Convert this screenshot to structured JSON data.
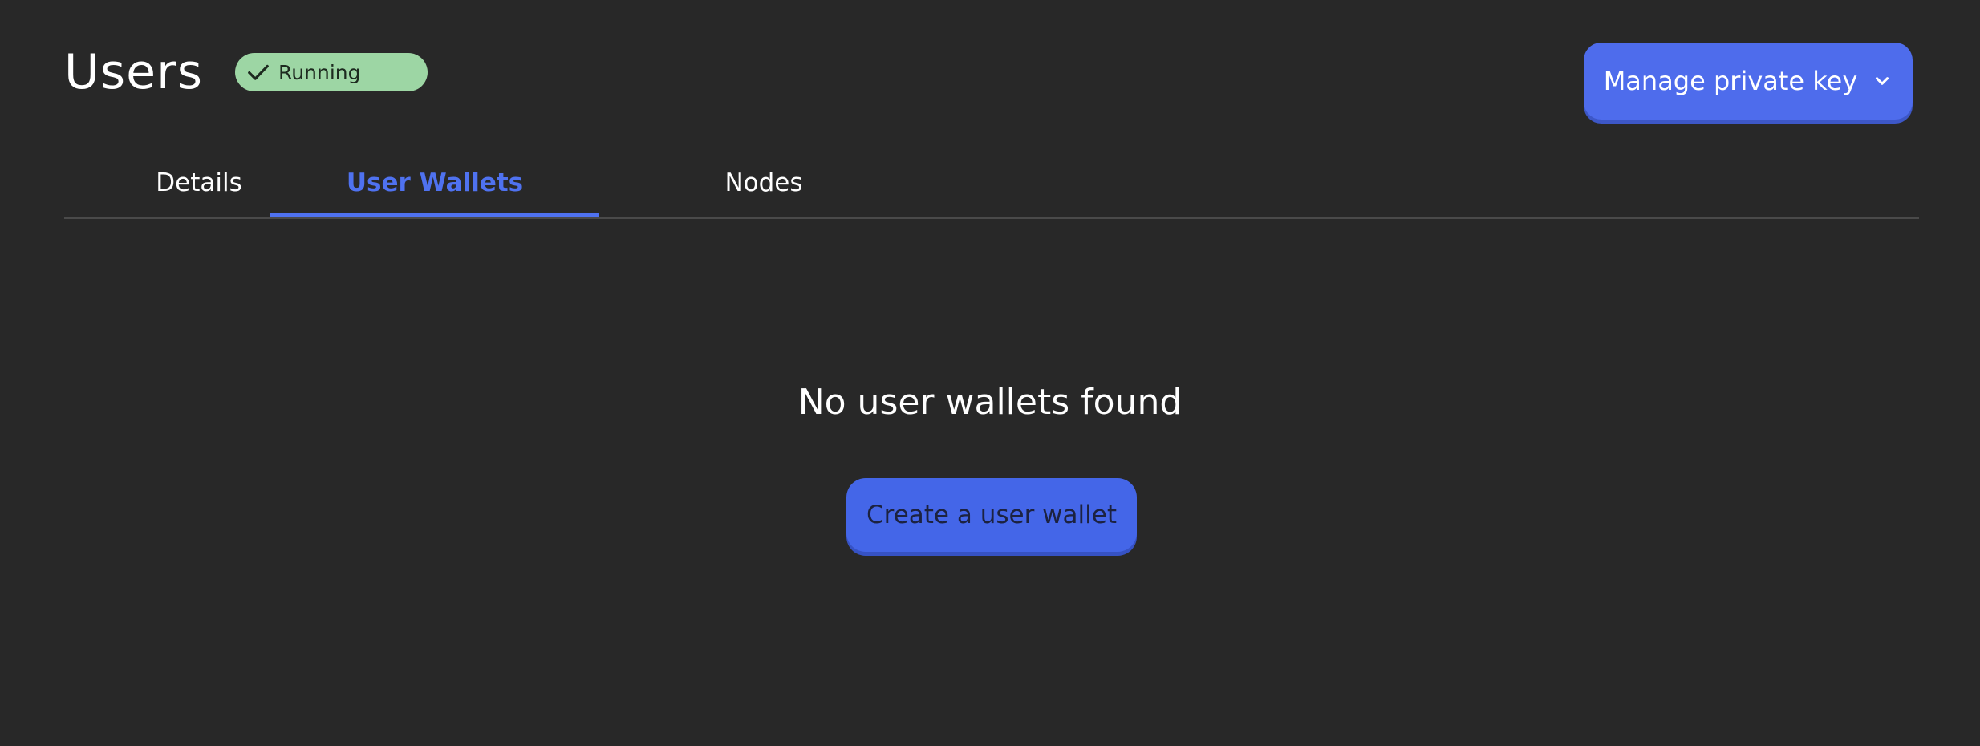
{
  "header": {
    "title": "Users",
    "status": "Running",
    "status_icon": "check-icon",
    "status_color": "#9dd6a4"
  },
  "actions": {
    "manage_label": "Manage private key",
    "manage_icon": "chevron-down-icon",
    "accent_color": "#4e6cec"
  },
  "tabs": [
    {
      "label": "Details",
      "active": false
    },
    {
      "label": "User Wallets",
      "active": true
    },
    {
      "label": "Nodes",
      "active": false
    }
  ],
  "empty_state": {
    "message": "No user wallets found",
    "button_label": "Create a user wallet"
  }
}
